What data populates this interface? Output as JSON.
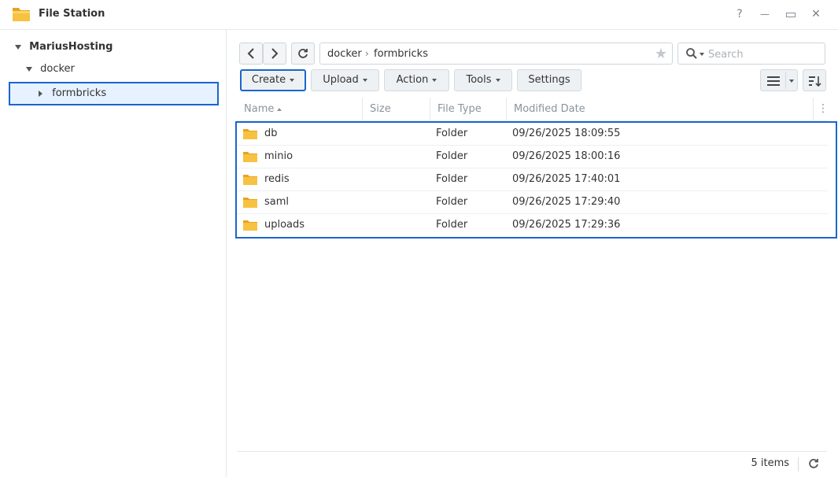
{
  "window": {
    "title": "File Station",
    "help_glyph": "?",
    "minimize_glyph": "—",
    "maximize_glyph": "▭",
    "close_glyph": "✕"
  },
  "sidebar": {
    "tree": [
      {
        "label": "MariusHosting",
        "level": 0,
        "expanded": true,
        "bold": true
      },
      {
        "label": "docker",
        "level": 1,
        "expanded": true,
        "bold": false
      },
      {
        "label": "formbricks",
        "level": 2,
        "expanded": false,
        "bold": false,
        "selected": true
      }
    ]
  },
  "navigation": {
    "back_glyph": "‹",
    "forward_glyph": "›",
    "refresh_glyph": "↻",
    "path": [
      "docker",
      "formbricks"
    ],
    "path_separator": "›",
    "star_glyph": "★"
  },
  "search": {
    "placeholder": "Search"
  },
  "toolbar": {
    "create": "Create",
    "upload": "Upload",
    "action": "Action",
    "tools": "Tools",
    "settings": "Settings"
  },
  "table": {
    "columns": [
      "Name",
      "Size",
      "File Type",
      "Modified Date"
    ],
    "column_menu_glyph": "⋮",
    "rows": [
      {
        "name": "db",
        "size": "",
        "type": "Folder",
        "modified": "09/26/2025 18:09:55"
      },
      {
        "name": "minio",
        "size": "",
        "type": "Folder",
        "modified": "09/26/2025 18:00:16"
      },
      {
        "name": "redis",
        "size": "",
        "type": "Folder",
        "modified": "09/26/2025 17:40:01"
      },
      {
        "name": "saml",
        "size": "",
        "type": "Folder",
        "modified": "09/26/2025 17:29:40"
      },
      {
        "name": "uploads",
        "size": "",
        "type": "Folder",
        "modified": "09/26/2025 17:29:36"
      }
    ]
  },
  "footer": {
    "item_count": "5 items",
    "refresh_glyph": "↻"
  },
  "colors": {
    "accent": "#1a66cc",
    "folder": "#f6b73c",
    "selection_bg": "#e6f2ff"
  }
}
